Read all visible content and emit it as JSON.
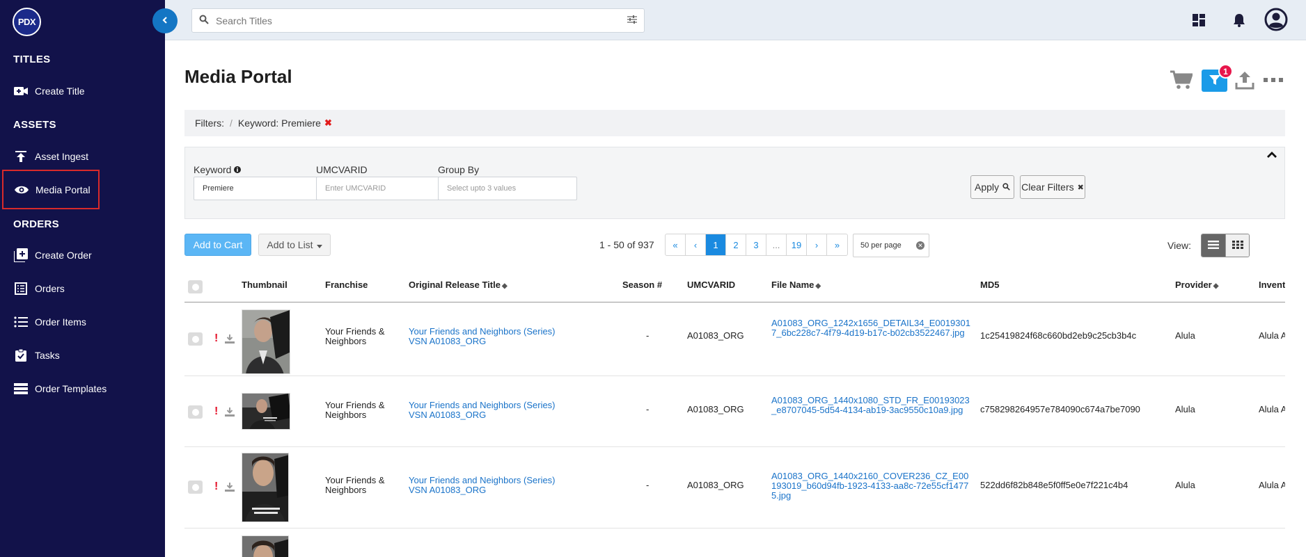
{
  "sidebar": {
    "logo": "PDX",
    "sections": {
      "titles": "TITLES",
      "assets": "ASSETS",
      "orders": "ORDERS"
    },
    "items": {
      "create_title": "Create Title",
      "asset_ingest": "Asset Ingest",
      "media_portal": "Media Portal",
      "create_order": "Create Order",
      "orders": "Orders",
      "order_items": "Order Items",
      "tasks": "Tasks",
      "order_templates": "Order Templates"
    }
  },
  "search": {
    "placeholder": "Search Titles",
    "value": ""
  },
  "page": {
    "title": "Media Portal",
    "filter_badge": "1"
  },
  "filterbar": {
    "label": "Filters:",
    "separator": "/",
    "chip": "Keyword: Premiere",
    "remove": "✖"
  },
  "filterpanel": {
    "keyword_label": "Keyword",
    "keyword_value": "Premiere",
    "umcvarid_label": "UMCVARID",
    "umcvarid_placeholder": "Enter UMCVARID",
    "groupby_label": "Group By",
    "groupby_placeholder": "Select upto 3 values",
    "apply": "Apply",
    "clear": "Clear Filters",
    "clear_x": "✖"
  },
  "toolbar": {
    "add_to_cart": "Add to Cart",
    "add_to_list": "Add to List",
    "range": "1 - 50 of 937",
    "pages": [
      "«",
      "‹",
      "1",
      "2",
      "3",
      "...",
      "19",
      "›",
      "»"
    ],
    "active_page": "1",
    "per_page": "50 per page",
    "per_page_clear": "✕",
    "view_label": "View:"
  },
  "table": {
    "headers": {
      "thumbnail": "Thumbnail",
      "franchise": "Franchise",
      "original_release_title": "Original Release Title",
      "season": "Season #",
      "umcvarid": "UMCVARID",
      "file_name": "File Name",
      "md5": "MD5",
      "provider": "Provider",
      "inventory": "Invent"
    },
    "rows": [
      {
        "flag": "!",
        "franchise": "Your Friends & Neighbors",
        "title": "Your Friends and Neighbors (Series) VSN A01083_ORG",
        "season": "-",
        "umcvarid": "A01083_ORG",
        "file_name": "A01083_ORG_1242x1656_DETAIL34_E00193017_6bc228c7-4f79-4d19-b17c-b02cb3522467.jpg",
        "md5": "1c25419824f68c660bd2eb9c25cb3b4c",
        "provider": "Alula",
        "inventory": "Alula A"
      },
      {
        "flag": "!",
        "franchise": "Your Friends & Neighbors",
        "title": "Your Friends and Neighbors (Series) VSN A01083_ORG",
        "season": "-",
        "umcvarid": "A01083_ORG",
        "file_name": "A01083_ORG_1440x1080_STD_FR_E00193023_e8707045-5d54-4134-ab19-3ac9550c10a9.jpg",
        "md5": "c758298264957e784090c674a7be7090",
        "provider": "Alula",
        "inventory": "Alula A"
      },
      {
        "flag": "!",
        "franchise": "Your Friends & Neighbors",
        "title": "Your Friends and Neighbors (Series) VSN A01083_ORG",
        "season": "-",
        "umcvarid": "A01083_ORG",
        "file_name": "A01083_ORG_1440x2160_COVER236_CZ_E00193019_b60d94fb-1923-4133-aa8c-72e55cf14775.jpg",
        "md5": "522dd6f82b848e5f0ff5e0e7f221c4b4",
        "provider": "Alula",
        "inventory": "Alula A"
      }
    ]
  },
  "colors": {
    "sidebar_bg": "#12124a",
    "accent": "#1a8ae0",
    "badge": "#e7164b",
    "highlight_box": "#d92a2a",
    "link": "#1a73c9"
  }
}
